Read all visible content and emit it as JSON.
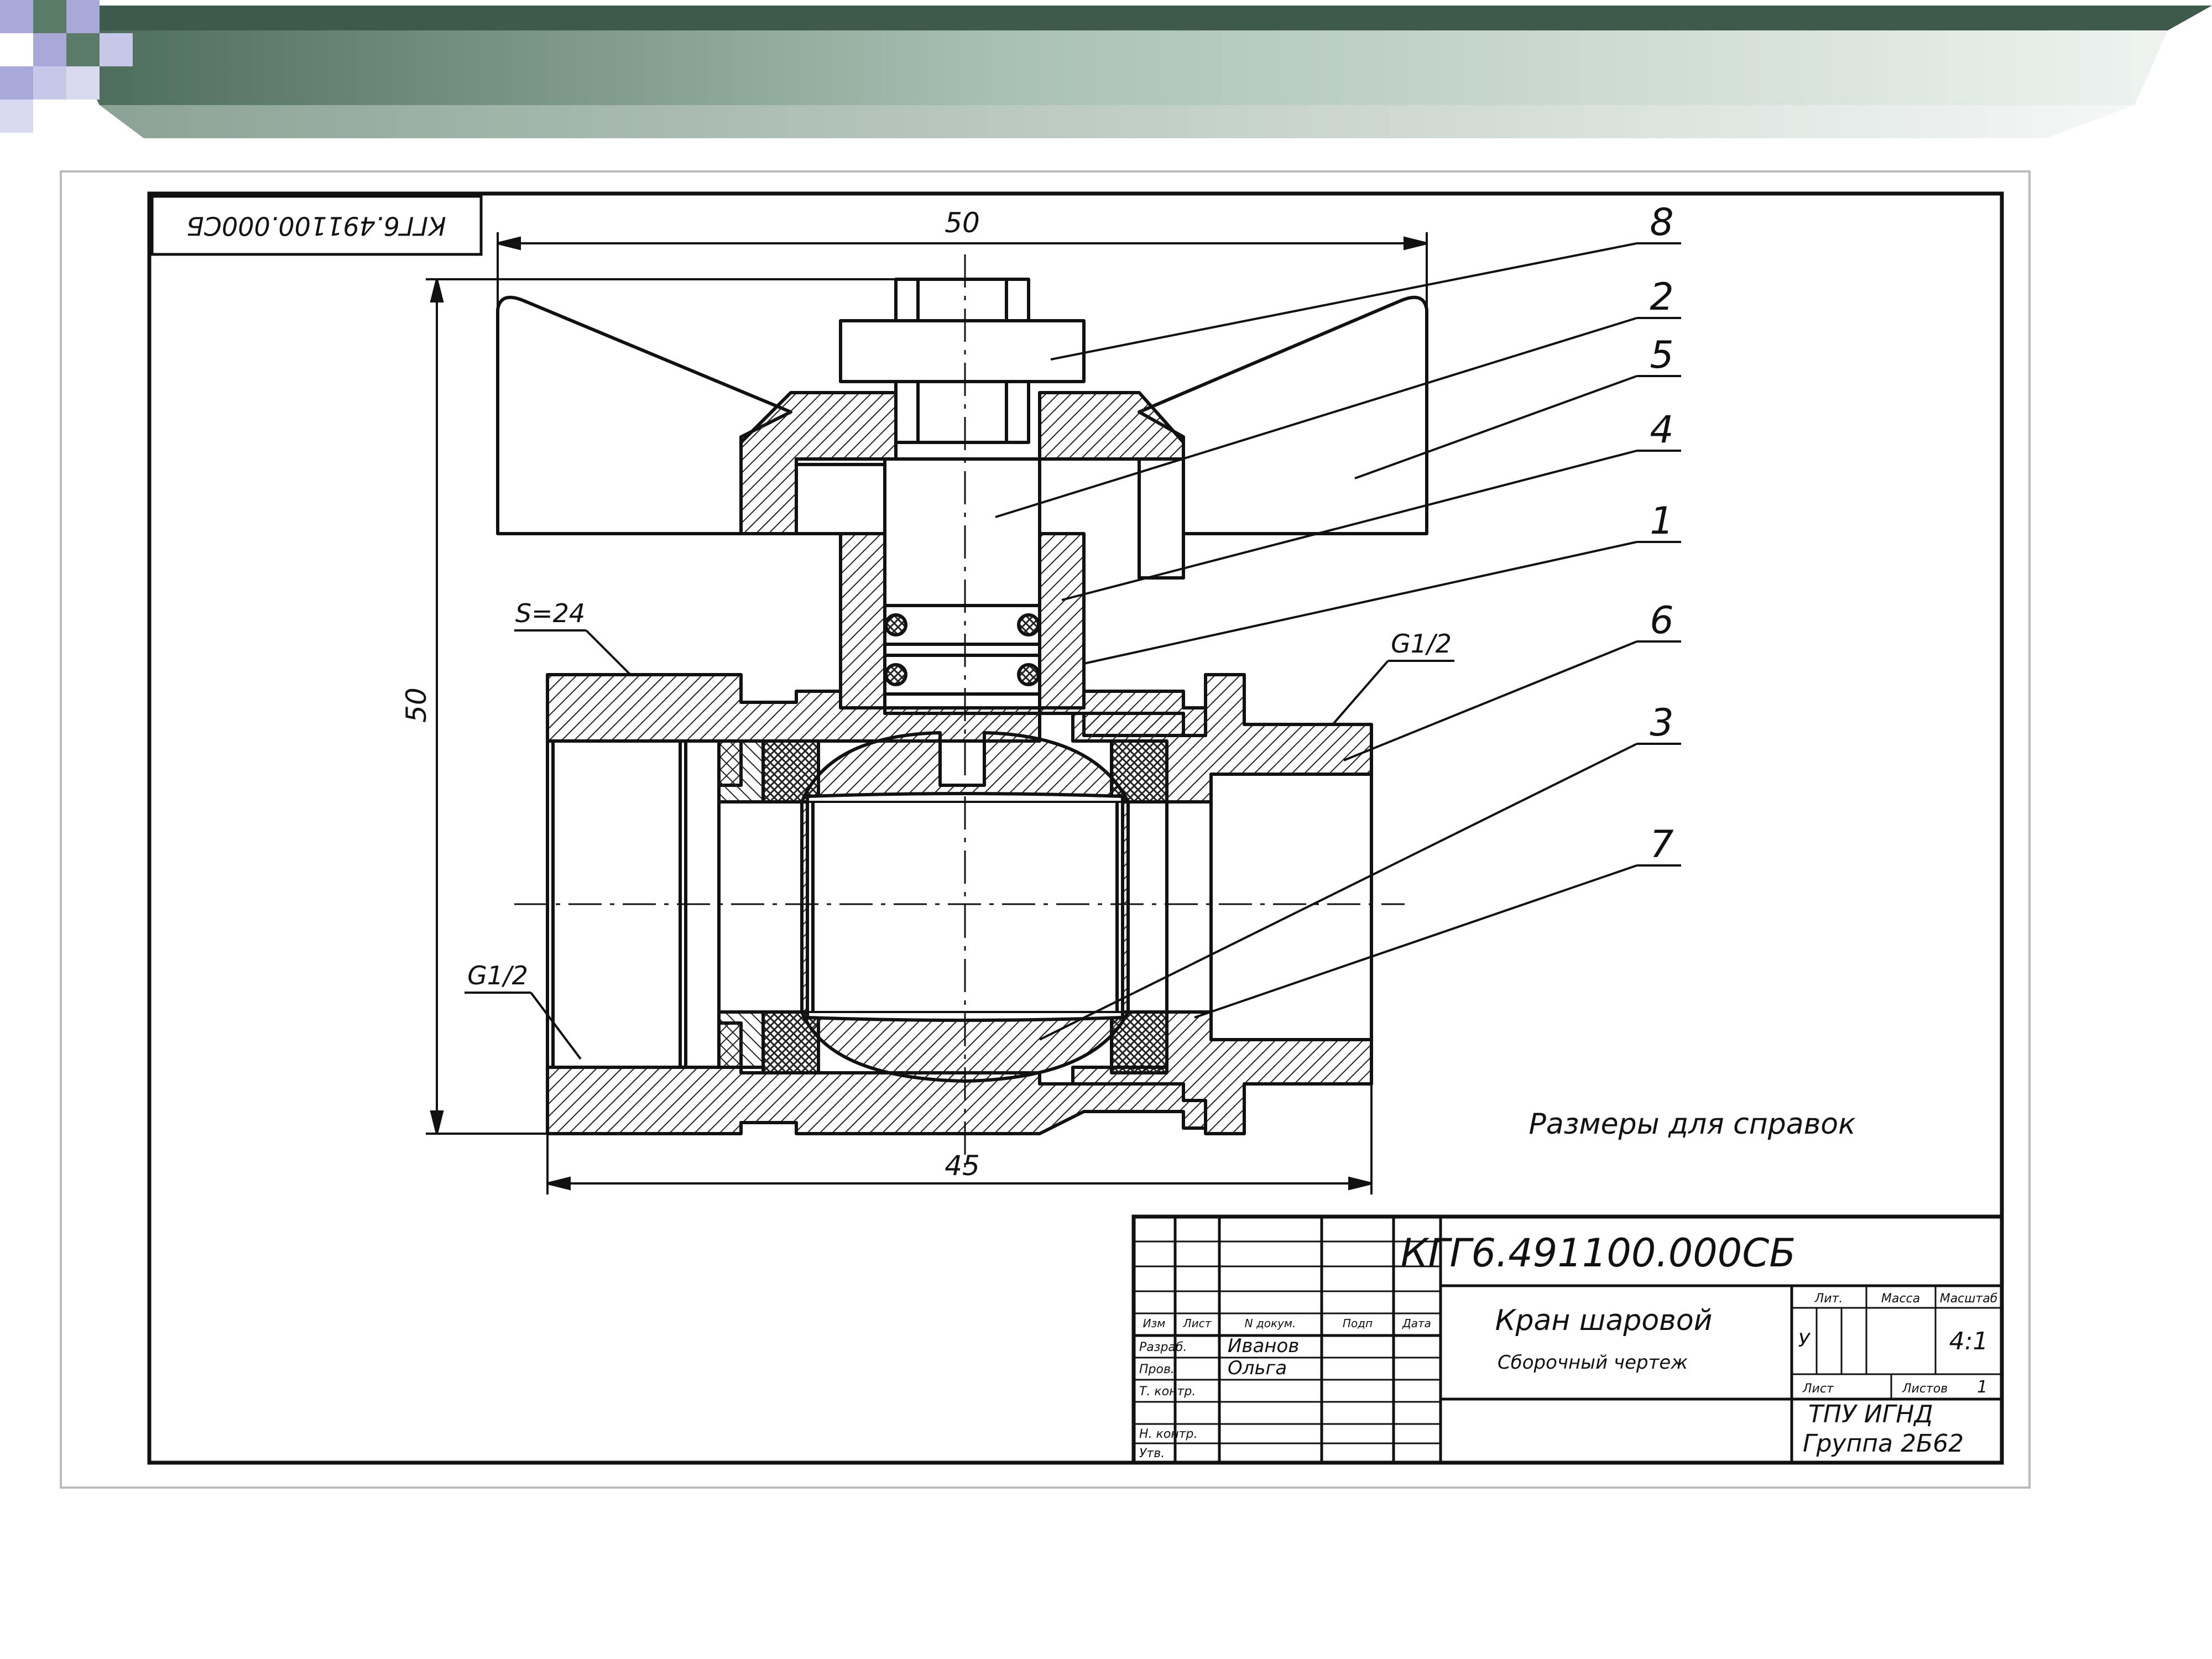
{
  "header": {
    "colors": {
      "banner_dark": "#4a6a58",
      "banner_light": "#dfe9e3",
      "squares": "#a9a9d9",
      "squares_dark": "#5a7b68"
    }
  },
  "drawing": {
    "stamp_code_rotated": "КГГ6.491100.000СБ",
    "dim_top": "50",
    "dim_left": "50",
    "dim_bottom": "45",
    "label_s": "S=24",
    "label_thread_left": "G1/2",
    "label_thread_right": "G1/2",
    "note": "Размеры для справок",
    "callouts": [
      "8",
      "2",
      "5",
      "4",
      "1",
      "6",
      "3",
      "7"
    ]
  },
  "title_block": {
    "code": "КГГ6.491100.000СБ",
    "name": "Кран шаровой",
    "doc_type": "Сборочный чертеж",
    "col_izm": "Изм",
    "col_list": "Лист",
    "col_doc": "N докум.",
    "col_sign": "Подп",
    "col_date": "Дата",
    "row_razrab": "Разраб.",
    "row_prov": "Пров.",
    "row_tkontr": "Т. контр.",
    "row_nkontr": "Н. контр.",
    "row_utv": "Утв.",
    "razrab_name": "Иванов",
    "prov_name": "Ольга",
    "lit_label": "Лит.",
    "mass_label": "Масса",
    "scale_label": "Масштаб",
    "lit_value": "У",
    "scale_value": "4:1",
    "sheet_label": "Лист",
    "sheets_label": "Листов",
    "sheets_value": "1",
    "org": "ТПУ   ИГНД",
    "group": "Группа   2Б62"
  }
}
